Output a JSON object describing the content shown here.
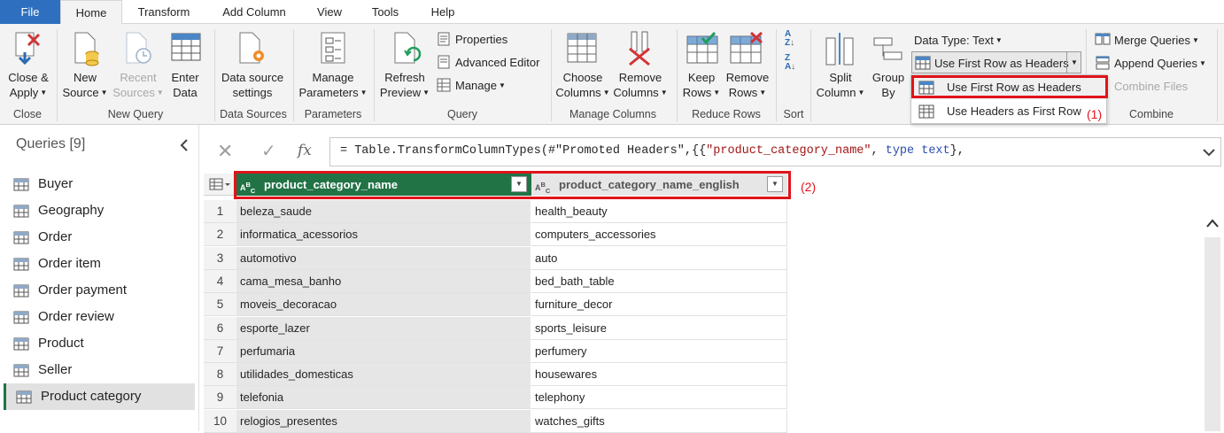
{
  "tabs": [
    "File",
    "Home",
    "Transform",
    "Add Column",
    "View",
    "Tools",
    "Help"
  ],
  "ribbon": {
    "close_group": {
      "btn": "Close &\nApply",
      "label": "Close"
    },
    "new_query_group": {
      "new_source": "New\nSource",
      "recent_sources": "Recent\nSources",
      "enter_data": "Enter\nData",
      "label": "New Query"
    },
    "data_sources_group": {
      "btn": "Data source\nsettings",
      "label": "Data Sources"
    },
    "parameters_group": {
      "btn": "Manage\nParameters",
      "label": "Parameters"
    },
    "query_group": {
      "refresh": "Refresh\nPreview",
      "properties": "Properties",
      "advanced_editor": "Advanced Editor",
      "manage": "Manage",
      "label": "Query"
    },
    "manage_columns_group": {
      "choose": "Choose\nColumns",
      "remove": "Remove\nColumns",
      "label": "Manage Columns"
    },
    "reduce_rows_group": {
      "keep": "Keep\nRows",
      "remove": "Remove\nRows",
      "label": "Reduce Rows"
    },
    "sort_group": {
      "label": "Sort"
    },
    "transform_group": {
      "split": "Split\nColumn",
      "group_by": "Group\nBy",
      "data_type": "Data Type: Text",
      "first_row": "Use First Row as Headers"
    },
    "combine_group": {
      "merge": "Merge Queries",
      "append": "Append Queries",
      "combine_files": "Combine Files",
      "label": "Combine"
    }
  },
  "dropdown": {
    "items": [
      "Use First Row as Headers",
      "Use Headers as First Row"
    ]
  },
  "annotations": {
    "one": "(1)",
    "two": "(2)"
  },
  "sidebar": {
    "title": "Queries [9]",
    "items": [
      "Buyer",
      "Geography",
      "Order",
      "Order item",
      "Order payment",
      "Order review",
      "Product",
      "Seller",
      "Product category"
    ],
    "selected": "Product category"
  },
  "formula": {
    "fx": "fx",
    "text_prefix": "= Table.TransformColumnTypes(#\"Promoted Headers\",{{",
    "text_string": "\"product_category_name\"",
    "text_mid": ", ",
    "text_kw": "type text",
    "text_suffix": "},"
  },
  "table": {
    "type_icon": "ABC",
    "columns": [
      "product_category_name",
      "product_category_name_english"
    ],
    "rows": [
      [
        "1",
        "beleza_saude",
        "health_beauty"
      ],
      [
        "2",
        "informatica_acessorios",
        "computers_accessories"
      ],
      [
        "3",
        "automotivo",
        "auto"
      ],
      [
        "4",
        "cama_mesa_banho",
        "bed_bath_table"
      ],
      [
        "5",
        "moveis_decoracao",
        "furniture_decor"
      ],
      [
        "6",
        "esporte_lazer",
        "sports_leisure"
      ],
      [
        "7",
        "perfumaria",
        "perfumery"
      ],
      [
        "8",
        "utilidades_domesticas",
        "housewares"
      ],
      [
        "9",
        "telefonia",
        "telephony"
      ],
      [
        "10",
        "relogios_presentes",
        "watches_gifts"
      ]
    ]
  },
  "colors": {
    "accent_green": "#217346",
    "header_green": "#217346",
    "highlight_red": "#e0141a",
    "file_blue": "#2f6fbf"
  }
}
